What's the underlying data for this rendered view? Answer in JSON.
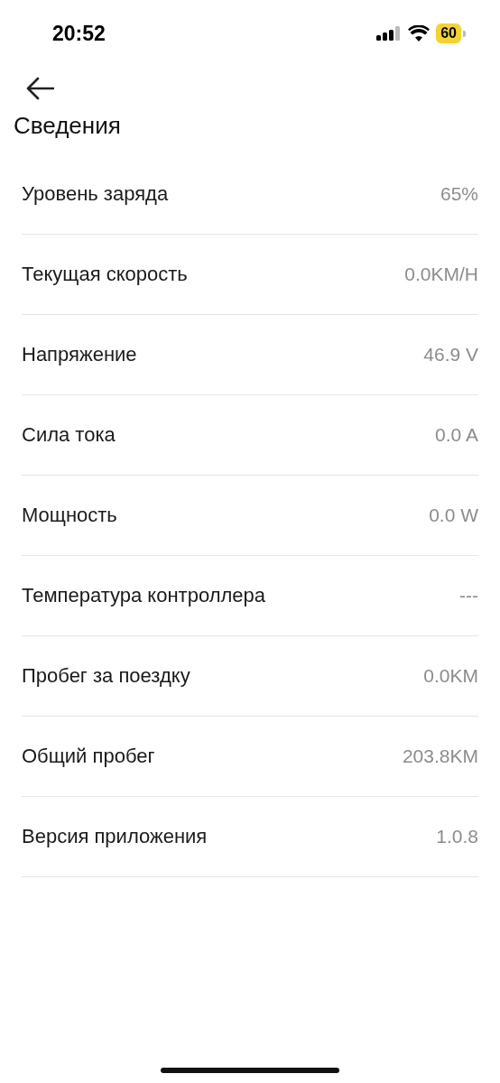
{
  "status_bar": {
    "time": "20:52",
    "battery": "60"
  },
  "title": "Сведения",
  "rows": [
    {
      "label": "Уровень заряда",
      "value": "65%"
    },
    {
      "label": "Текущая скорость",
      "value": "0.0KM/H"
    },
    {
      "label": "Напряжение",
      "value": "46.9 V"
    },
    {
      "label": "Сила тока",
      "value": "0.0 A"
    },
    {
      "label": "Мощность",
      "value": "0.0 W"
    },
    {
      "label": "Температура контроллера",
      "value": "---"
    },
    {
      "label": "Пробег за поездку",
      "value": "0.0KM"
    },
    {
      "label": "Общий пробег",
      "value": "203.8KM"
    },
    {
      "label": "Версия приложения",
      "value": "1.0.8"
    }
  ]
}
